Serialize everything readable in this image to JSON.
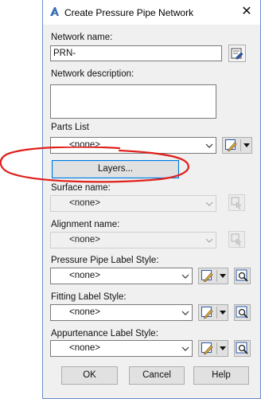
{
  "window": {
    "title": "Create Pressure Pipe Network"
  },
  "network_name": {
    "label": "Network name:",
    "value": "PRN-"
  },
  "network_description": {
    "label": "Network description:",
    "value": ""
  },
  "parts_list": {
    "label": "Parts List",
    "selected": "<none>"
  },
  "layers_button": {
    "label": "Layers..."
  },
  "surface_name": {
    "label": "Surface name:",
    "selected": "<none>"
  },
  "alignment_name": {
    "label": "Alignment name:",
    "selected": "<none>"
  },
  "pressure_pipe_label_style": {
    "label": "Pressure Pipe Label Style:",
    "selected": "<none>"
  },
  "fitting_label_style": {
    "label": "Fitting Label Style:",
    "selected": "<none>"
  },
  "appurtenance_label_style": {
    "label": "Appurtenance Label Style:",
    "selected": "<none>"
  },
  "buttons": {
    "ok": "OK",
    "cancel": "Cancel",
    "help": "Help"
  },
  "annotation": {
    "color": "#e0201b"
  }
}
